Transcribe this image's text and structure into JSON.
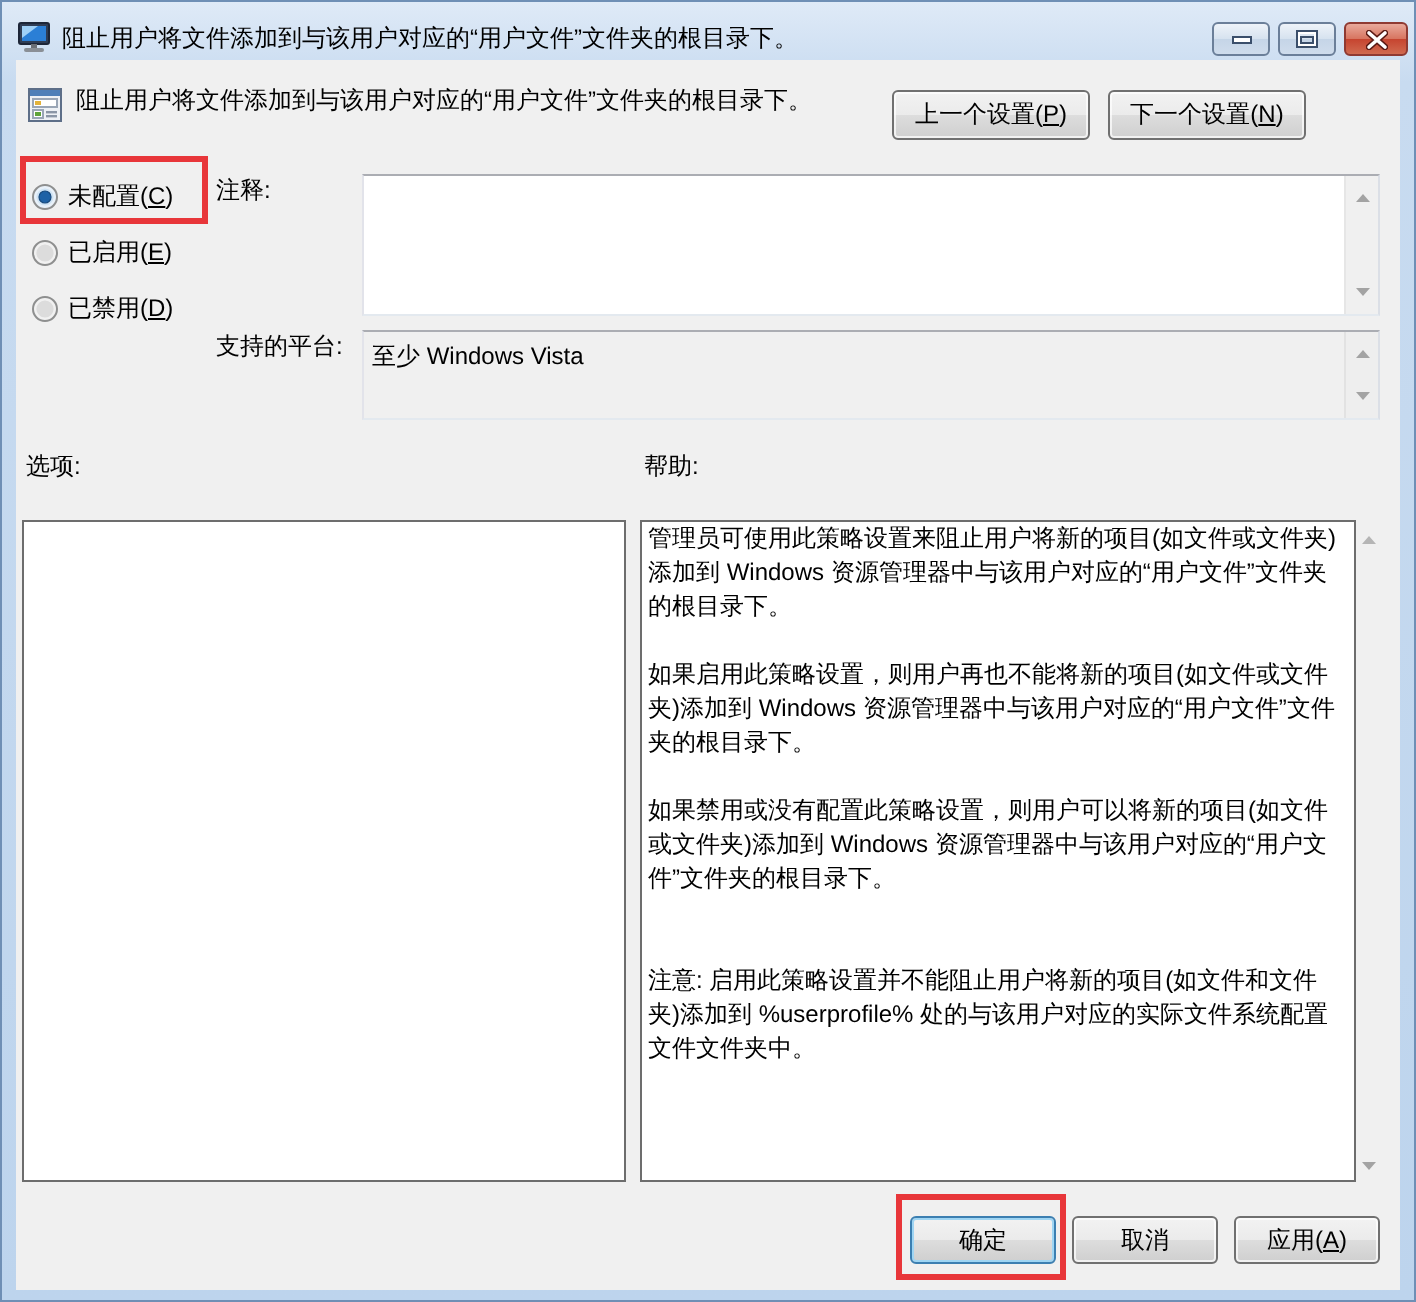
{
  "window": {
    "title": "阻止用户将文件添加到与该用户对应的“用户文件”文件夹的根目录下。"
  },
  "header": {
    "policy_name": "阻止用户将文件添加到与该用户对应的“用户文件”文件夹的根目录下。",
    "buttons": [
      {
        "text": "上一个设置(",
        "access_key": "P",
        "text_end": ")"
      },
      {
        "text": "下一个设置(",
        "access_key": "N",
        "text_end": ")"
      }
    ]
  },
  "state_options": [
    {
      "text": "未配置(",
      "access_key": "C",
      "text_end": ")",
      "selected": true,
      "highlighted": true
    },
    {
      "text": "已启用(",
      "access_key": "E",
      "text_end": ")",
      "selected": false,
      "highlighted": false
    },
    {
      "text": "已禁用(",
      "access_key": "D",
      "text_end": ")",
      "selected": false,
      "highlighted": false
    }
  ],
  "comment": {
    "label": "注释:"
  },
  "supported_on": {
    "label": "支持的平台:",
    "value": "至少 Windows Vista"
  },
  "options": {
    "label": "选项:"
  },
  "help": {
    "label": "帮助:",
    "paragraphs": [
      {
        "kind": "text",
        "text": "管理员可使用此策略设置来阻止用户将新的项目(如文件或文件夹)添加到 Windows 资源管理器中与该用户对应的“用户文件”文件夹的根目录下。"
      },
      {
        "kind": "text",
        "text": "如果启用此策略设置，则用户再也不能将新的项目(如文件或文件夹)添加到 Windows 资源管理器中与该用户对应的“用户文件”文件夹的根目录下。"
      },
      {
        "kind": "text",
        "text": "如果禁用或没有配置此策略设置，则用户可以将新的项目(如文件或文件夹)添加到 Windows 资源管理器中与该用户对应的“用户文件”文件夹的根目录下。"
      },
      {
        "kind": "note",
        "text": "注意: 启用此策略设置并不能阻止用户将新的项目(如文件和文件夹)添加到 %userprofile% 处的与该用户对应的实际文件系统配置文件文件夹中。"
      }
    ]
  },
  "buttons": [
    {
      "text": "确定",
      "default": true,
      "highlighted": true
    },
    {
      "text": "取消",
      "default": false,
      "highlighted": false
    },
    {
      "text": "应用(",
      "access_key": "A",
      "text_end": ")",
      "default": false,
      "highlighted": false
    }
  ]
}
